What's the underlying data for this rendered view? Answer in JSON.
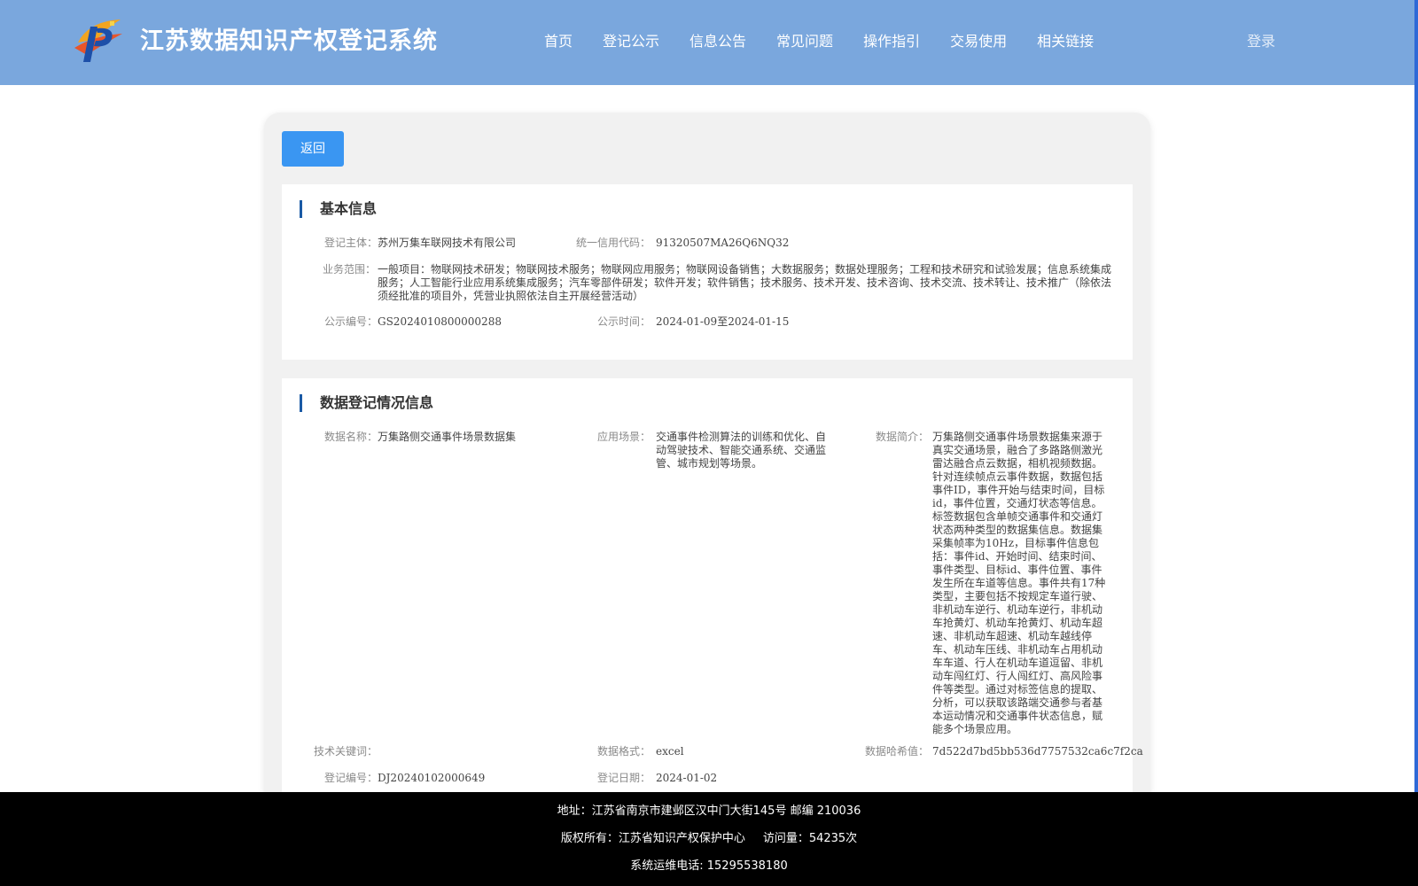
{
  "header": {
    "site_title": "江苏数据知识产权登记系统",
    "nav": [
      "首页",
      "登记公示",
      "信息公告",
      "常见问题",
      "操作指引",
      "交易使用",
      "相关链接"
    ],
    "login": "登录"
  },
  "back_button": "返回",
  "basic_info": {
    "title": "基本信息",
    "subject_label": "登记主体：",
    "subject_value": "苏州万集车联网技术有限公司",
    "credit_label": "统一信用代码：",
    "credit_value": "91320507MA26Q6NQ32",
    "scope_label": "业务范围：",
    "scope_value": "一般项目：物联网技术研发；物联网技术服务；物联网应用服务；物联网设备销售；大数据服务；数据处理服务；工程和技术研究和试验发展；信息系统集成服务；人工智能行业应用系统集成服务；汽车零部件研发；软件开发；软件销售；技术服务、技术开发、技术咨询、技术交流、技术转让、技术推广（除依法须经批准的项目外，凭营业执照依法自主开展经营活动）",
    "notice_no_label": "公示编号：",
    "notice_no_value": "GS2024010800000288",
    "notice_time_label": "公示时间：",
    "notice_time_value": "2024-01-09至2024-01-15"
  },
  "data_info": {
    "title": "数据登记情况信息",
    "name_label": "数据名称：",
    "name_value": "万集路侧交通事件场景数据集",
    "scene_label": "应用场景：",
    "scene_value": "交通事件检测算法的训练和优化、自动驾驶技术、智能交通系统、交通监管、城市规划等场景。",
    "intro_label": "数据简介：",
    "intro_value": "万集路侧交通事件场景数据集来源于真实交通场景，融合了多路路侧激光雷达融合点云数据，相机视频数据。针对连续帧点云事件数据，数据包括事件ID，事件开始与结束时间，目标id，事件位置，交通灯状态等信息。标签数据包含单帧交通事件和交通灯状态两种类型的数据集信息。数据集采集帧率为10Hz，目标事件信息包括：事件id、开始时间、结束时间、事件类型、目标id、事件位置、事件发生所在车道等信息。事件共有17种类型，主要包括不按规定车道行驶、非机动车逆行、机动车逆行，非机动车抢黄灯、机动车抢黄灯、机动车超速、非机动车超速、机动车越线停车、机动车压线、非机动车占用机动车车道、行人在机动车道逗留、非机动车闯红灯、行人闯红灯、高风险事件等类型。通过对标签信息的提取、分析，可以获取该路端交通参与者基本运动情况和交通事件状态信息，赋能多个场景应用。",
    "keywords_label": "技术关键词：",
    "keywords_value": "",
    "format_label": "数据格式：",
    "format_value": "excel",
    "hash_label": "数据哈希值：",
    "hash_value": "7d522d7bd5bb536d7757532ca6c7f2ca",
    "reg_no_label": "登记编号：",
    "reg_no_value": "DJ20240102000649",
    "reg_date_label": "登记日期：",
    "reg_date_value": "2024-01-02"
  },
  "footer": {
    "address": "地址：江苏省南京市建邺区汉中门大街145号 邮编 210036",
    "copyright": "版权所有：江苏省知识产权保护中心",
    "visits": "访问量：54235次",
    "phone": "系统运维电话: 15295538180"
  },
  "colors": {
    "header_bg": "#7aa7dd",
    "button_bg": "#3a96f2",
    "title_accent": "#1a5aa5",
    "footer_bg": "#000000"
  }
}
